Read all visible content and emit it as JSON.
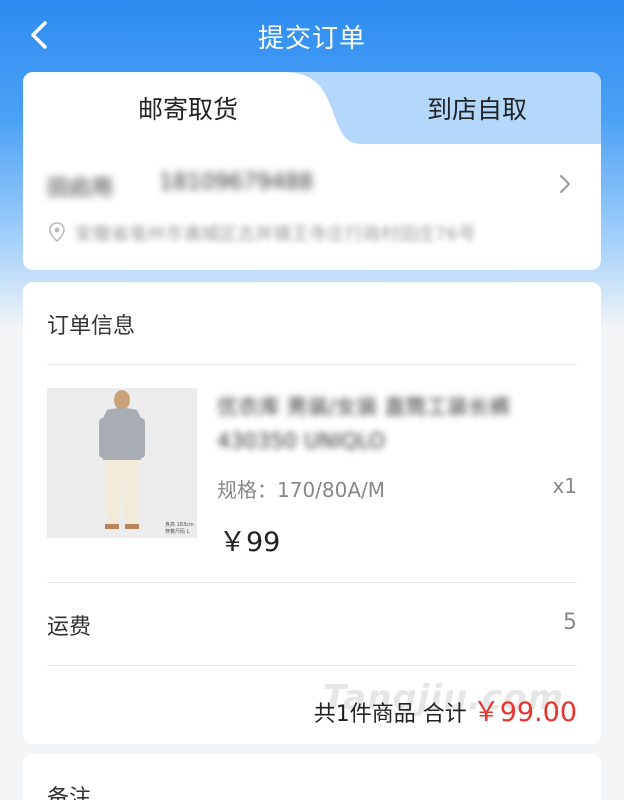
{
  "header": {
    "title": "提交订单",
    "back_icon": "chevron-left-icon"
  },
  "delivery_tabs": [
    {
      "label": "邮寄取货",
      "active": true
    },
    {
      "label": "到店自取",
      "active": false
    }
  ],
  "address": {
    "name": "田启用",
    "phone": "18109679488",
    "detail": "安徽省亳州市谯城区古井镇王寺庄行政村田庄76号"
  },
  "order": {
    "section_title": "订单信息",
    "product": {
      "name": "优衣库 男装/女装 直筒工装长裤 430350 UNIQLO",
      "spec": "规格：170/80A/M",
      "qty": "x1",
      "price": "￥99",
      "image_caption_1": "身高 183cm",
      "image_caption_2": "穿着尺码 L"
    },
    "freight_label": "运费",
    "freight_value": "5",
    "total_prefix": "共1件商品 合计",
    "total_amount": "￥99.00"
  },
  "watermark": "Tangjiu.com",
  "remark": {
    "label": "备注"
  },
  "colors": {
    "primary": "#2d8bf0",
    "tab_inactive": "#b3d8fb",
    "price_red": "#e8342f"
  }
}
